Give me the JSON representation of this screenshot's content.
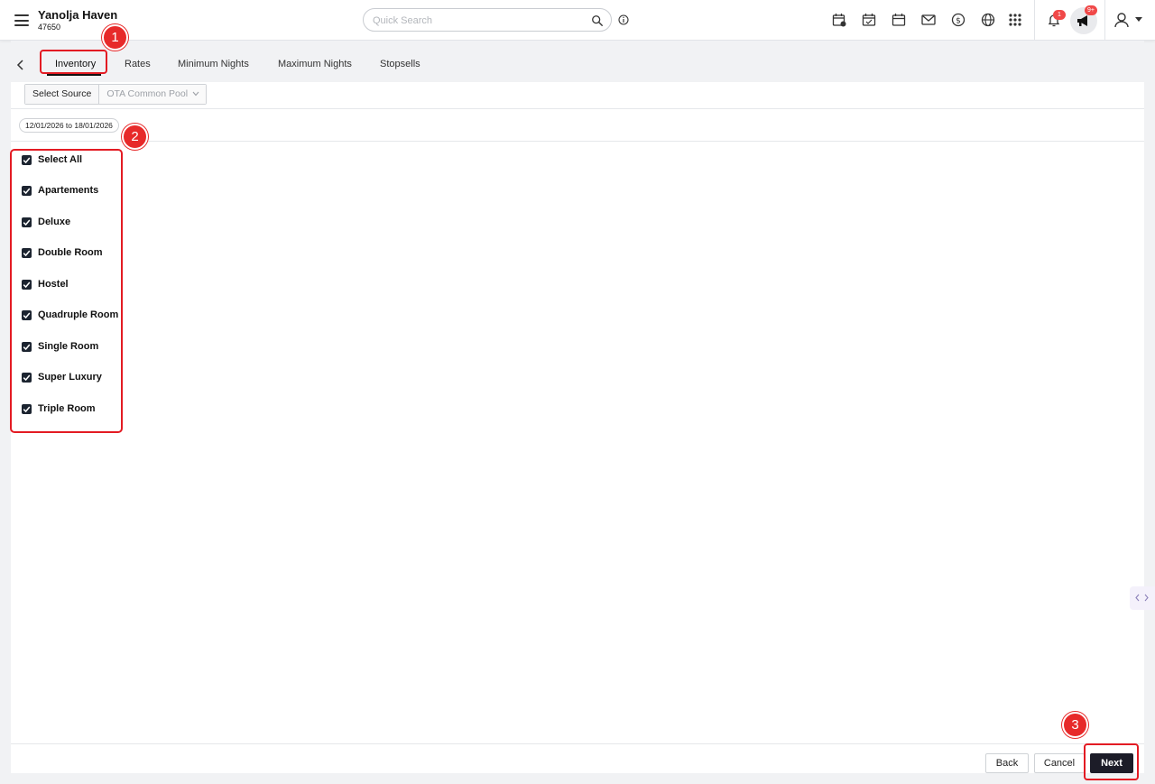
{
  "header": {
    "hotel_name": "Yanolja Haven",
    "hotel_id": "47650",
    "search_placeholder": "Quick Search",
    "notification_badge": "1",
    "announcement_badge": "9+"
  },
  "tabs": [
    {
      "label": "Inventory",
      "active": true
    },
    {
      "label": "Rates"
    },
    {
      "label": "Minimum Nights"
    },
    {
      "label": "Maximum Nights"
    },
    {
      "label": "Stopsells"
    }
  ],
  "source": {
    "label": "Select Source",
    "value": "OTA Common Pool"
  },
  "date_range": "12/01/2026 to 18/01/2026",
  "rooms": [
    {
      "label": "Select All",
      "checked": true
    },
    {
      "label": "Apartements",
      "checked": true
    },
    {
      "label": "Deluxe",
      "checked": true
    },
    {
      "label": "Double Room",
      "checked": true
    },
    {
      "label": "Hostel",
      "checked": true
    },
    {
      "label": "Quadruple Room",
      "checked": true
    },
    {
      "label": "Single Room",
      "checked": true
    },
    {
      "label": "Super Luxury",
      "checked": true
    },
    {
      "label": "Triple Room",
      "checked": true
    }
  ],
  "footer": {
    "back_label": "Back",
    "cancel_label": "Cancel",
    "next_label": "Next"
  },
  "steps": [
    "1",
    "2",
    "3"
  ],
  "colors": {
    "accent_red": "#e31b23",
    "dark_button": "#1c1c28",
    "checkbox": "#1c2430"
  }
}
